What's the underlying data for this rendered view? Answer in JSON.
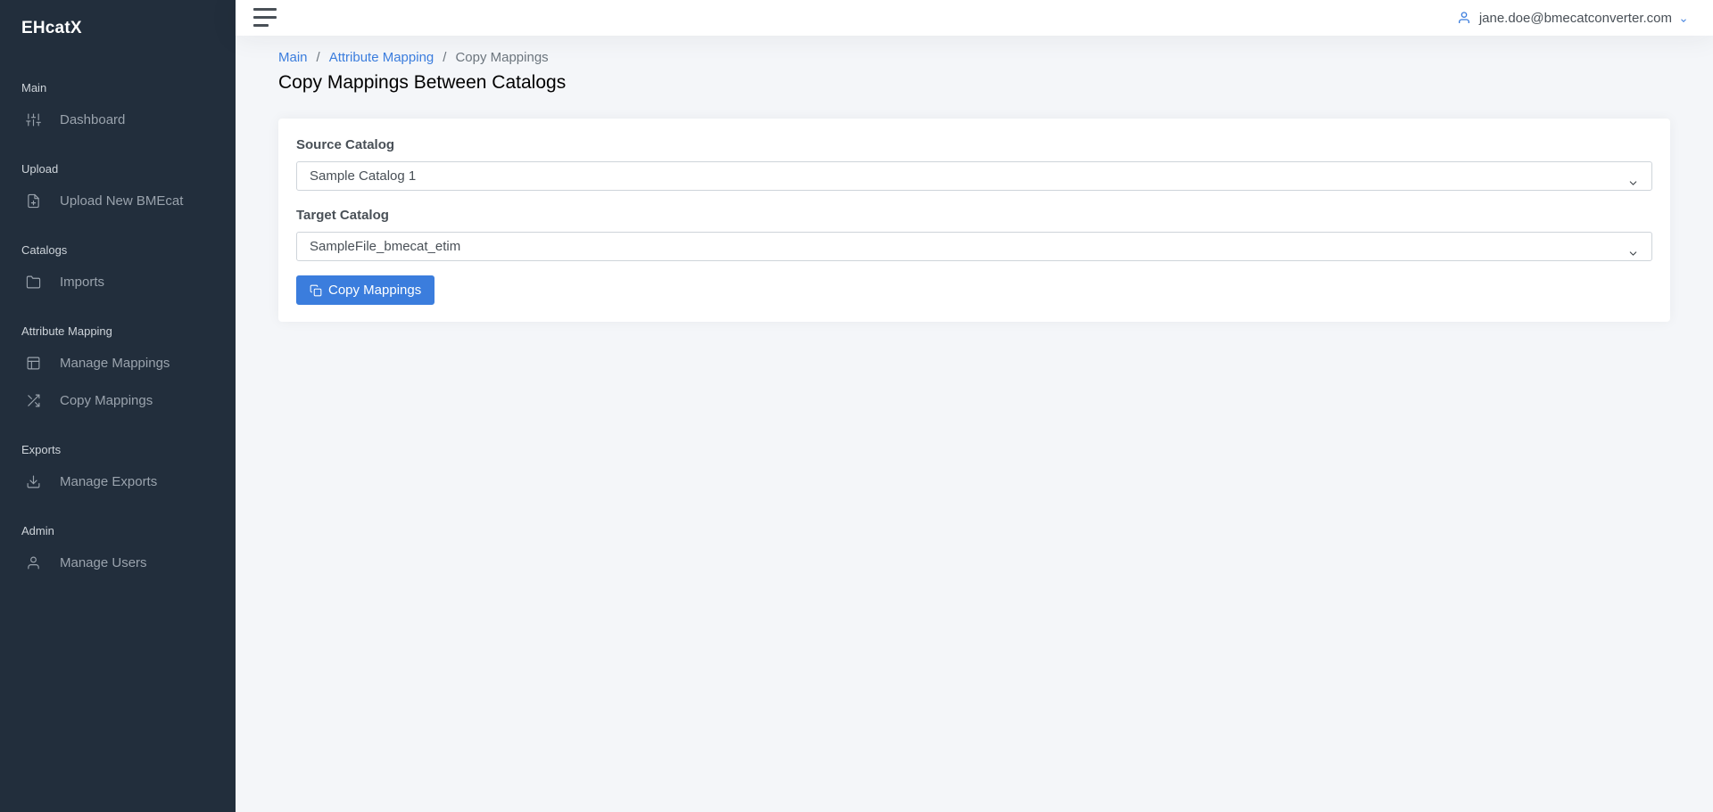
{
  "app": {
    "brand": "EHcatX"
  },
  "sidebar": {
    "sections": [
      {
        "header": "Main",
        "items": [
          {
            "label": "Dashboard",
            "icon": "sliders-icon"
          }
        ]
      },
      {
        "header": "Upload",
        "items": [
          {
            "label": "Upload New BMEcat",
            "icon": "file-plus-icon"
          }
        ]
      },
      {
        "header": "Catalogs",
        "items": [
          {
            "label": "Imports",
            "icon": "folder-icon"
          }
        ]
      },
      {
        "header": "Attribute Mapping",
        "items": [
          {
            "label": "Manage Mappings",
            "icon": "layout-icon"
          },
          {
            "label": "Copy Mappings",
            "icon": "shuffle-icon"
          }
        ]
      },
      {
        "header": "Exports",
        "items": [
          {
            "label": "Manage Exports",
            "icon": "download-icon"
          }
        ]
      },
      {
        "header": "Admin",
        "items": [
          {
            "label": "Manage Users",
            "icon": "user-icon"
          }
        ]
      }
    ]
  },
  "topbar": {
    "user_email": "jane.doe@bmecatconverter.com",
    "user_icon": "user-icon",
    "caret_icon": "chevron-down-icon"
  },
  "breadcrumb": {
    "items": [
      "Main",
      "Attribute Mapping"
    ],
    "current": "Copy Mappings",
    "separator": "/"
  },
  "page": {
    "title": "Copy Mappings Between Catalogs"
  },
  "form": {
    "source_label": "Source Catalog",
    "source_value": "Sample Catalog 1",
    "target_label": "Target Catalog",
    "target_value": "SampleFile_bmecat_etim",
    "submit_label": "Copy Mappings"
  },
  "colors": {
    "sidebar_bg": "#222e3c",
    "accent": "#3b7ddd",
    "page_bg": "#f4f6f9"
  }
}
